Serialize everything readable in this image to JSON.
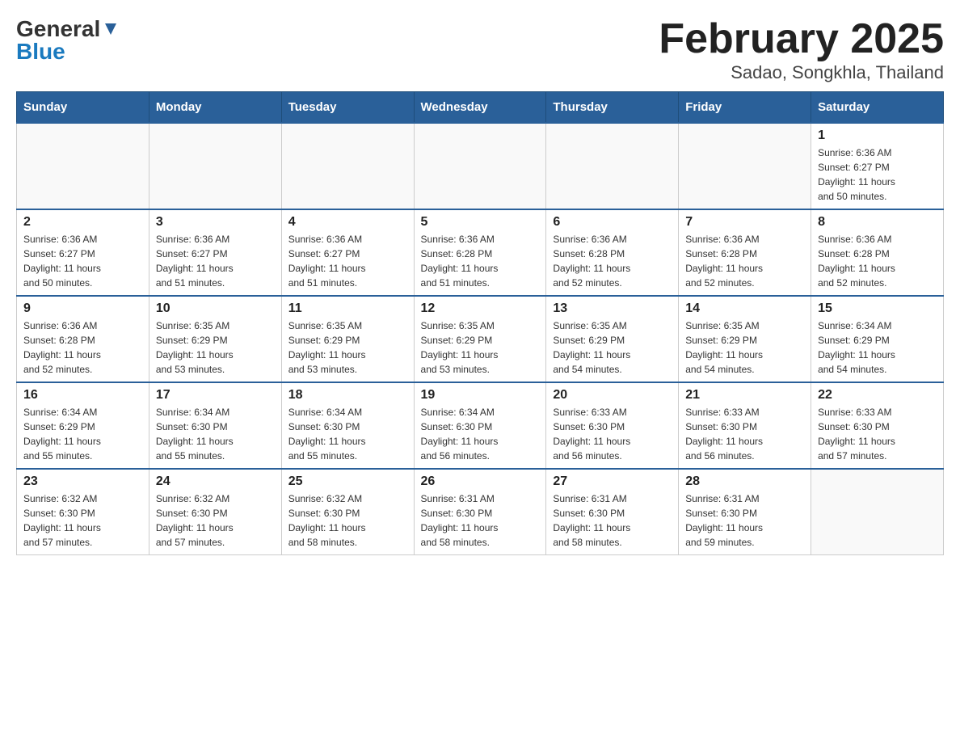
{
  "header": {
    "logo_line1": "General",
    "logo_line2": "Blue",
    "title": "February 2025",
    "subtitle": "Sadao, Songkhla, Thailand"
  },
  "days_of_week": [
    "Sunday",
    "Monday",
    "Tuesday",
    "Wednesday",
    "Thursday",
    "Friday",
    "Saturday"
  ],
  "weeks": [
    {
      "cells": [
        {
          "day": "",
          "info": ""
        },
        {
          "day": "",
          "info": ""
        },
        {
          "day": "",
          "info": ""
        },
        {
          "day": "",
          "info": ""
        },
        {
          "day": "",
          "info": ""
        },
        {
          "day": "",
          "info": ""
        },
        {
          "day": "1",
          "info": "Sunrise: 6:36 AM\nSunset: 6:27 PM\nDaylight: 11 hours\nand 50 minutes."
        }
      ]
    },
    {
      "cells": [
        {
          "day": "2",
          "info": "Sunrise: 6:36 AM\nSunset: 6:27 PM\nDaylight: 11 hours\nand 50 minutes."
        },
        {
          "day": "3",
          "info": "Sunrise: 6:36 AM\nSunset: 6:27 PM\nDaylight: 11 hours\nand 51 minutes."
        },
        {
          "day": "4",
          "info": "Sunrise: 6:36 AM\nSunset: 6:27 PM\nDaylight: 11 hours\nand 51 minutes."
        },
        {
          "day": "5",
          "info": "Sunrise: 6:36 AM\nSunset: 6:28 PM\nDaylight: 11 hours\nand 51 minutes."
        },
        {
          "day": "6",
          "info": "Sunrise: 6:36 AM\nSunset: 6:28 PM\nDaylight: 11 hours\nand 52 minutes."
        },
        {
          "day": "7",
          "info": "Sunrise: 6:36 AM\nSunset: 6:28 PM\nDaylight: 11 hours\nand 52 minutes."
        },
        {
          "day": "8",
          "info": "Sunrise: 6:36 AM\nSunset: 6:28 PM\nDaylight: 11 hours\nand 52 minutes."
        }
      ]
    },
    {
      "cells": [
        {
          "day": "9",
          "info": "Sunrise: 6:36 AM\nSunset: 6:28 PM\nDaylight: 11 hours\nand 52 minutes."
        },
        {
          "day": "10",
          "info": "Sunrise: 6:35 AM\nSunset: 6:29 PM\nDaylight: 11 hours\nand 53 minutes."
        },
        {
          "day": "11",
          "info": "Sunrise: 6:35 AM\nSunset: 6:29 PM\nDaylight: 11 hours\nand 53 minutes."
        },
        {
          "day": "12",
          "info": "Sunrise: 6:35 AM\nSunset: 6:29 PM\nDaylight: 11 hours\nand 53 minutes."
        },
        {
          "day": "13",
          "info": "Sunrise: 6:35 AM\nSunset: 6:29 PM\nDaylight: 11 hours\nand 54 minutes."
        },
        {
          "day": "14",
          "info": "Sunrise: 6:35 AM\nSunset: 6:29 PM\nDaylight: 11 hours\nand 54 minutes."
        },
        {
          "day": "15",
          "info": "Sunrise: 6:34 AM\nSunset: 6:29 PM\nDaylight: 11 hours\nand 54 minutes."
        }
      ]
    },
    {
      "cells": [
        {
          "day": "16",
          "info": "Sunrise: 6:34 AM\nSunset: 6:29 PM\nDaylight: 11 hours\nand 55 minutes."
        },
        {
          "day": "17",
          "info": "Sunrise: 6:34 AM\nSunset: 6:30 PM\nDaylight: 11 hours\nand 55 minutes."
        },
        {
          "day": "18",
          "info": "Sunrise: 6:34 AM\nSunset: 6:30 PM\nDaylight: 11 hours\nand 55 minutes."
        },
        {
          "day": "19",
          "info": "Sunrise: 6:34 AM\nSunset: 6:30 PM\nDaylight: 11 hours\nand 56 minutes."
        },
        {
          "day": "20",
          "info": "Sunrise: 6:33 AM\nSunset: 6:30 PM\nDaylight: 11 hours\nand 56 minutes."
        },
        {
          "day": "21",
          "info": "Sunrise: 6:33 AM\nSunset: 6:30 PM\nDaylight: 11 hours\nand 56 minutes."
        },
        {
          "day": "22",
          "info": "Sunrise: 6:33 AM\nSunset: 6:30 PM\nDaylight: 11 hours\nand 57 minutes."
        }
      ]
    },
    {
      "cells": [
        {
          "day": "23",
          "info": "Sunrise: 6:32 AM\nSunset: 6:30 PM\nDaylight: 11 hours\nand 57 minutes."
        },
        {
          "day": "24",
          "info": "Sunrise: 6:32 AM\nSunset: 6:30 PM\nDaylight: 11 hours\nand 57 minutes."
        },
        {
          "day": "25",
          "info": "Sunrise: 6:32 AM\nSunset: 6:30 PM\nDaylight: 11 hours\nand 58 minutes."
        },
        {
          "day": "26",
          "info": "Sunrise: 6:31 AM\nSunset: 6:30 PM\nDaylight: 11 hours\nand 58 minutes."
        },
        {
          "day": "27",
          "info": "Sunrise: 6:31 AM\nSunset: 6:30 PM\nDaylight: 11 hours\nand 58 minutes."
        },
        {
          "day": "28",
          "info": "Sunrise: 6:31 AM\nSunset: 6:30 PM\nDaylight: 11 hours\nand 59 minutes."
        },
        {
          "day": "",
          "info": ""
        }
      ]
    }
  ]
}
